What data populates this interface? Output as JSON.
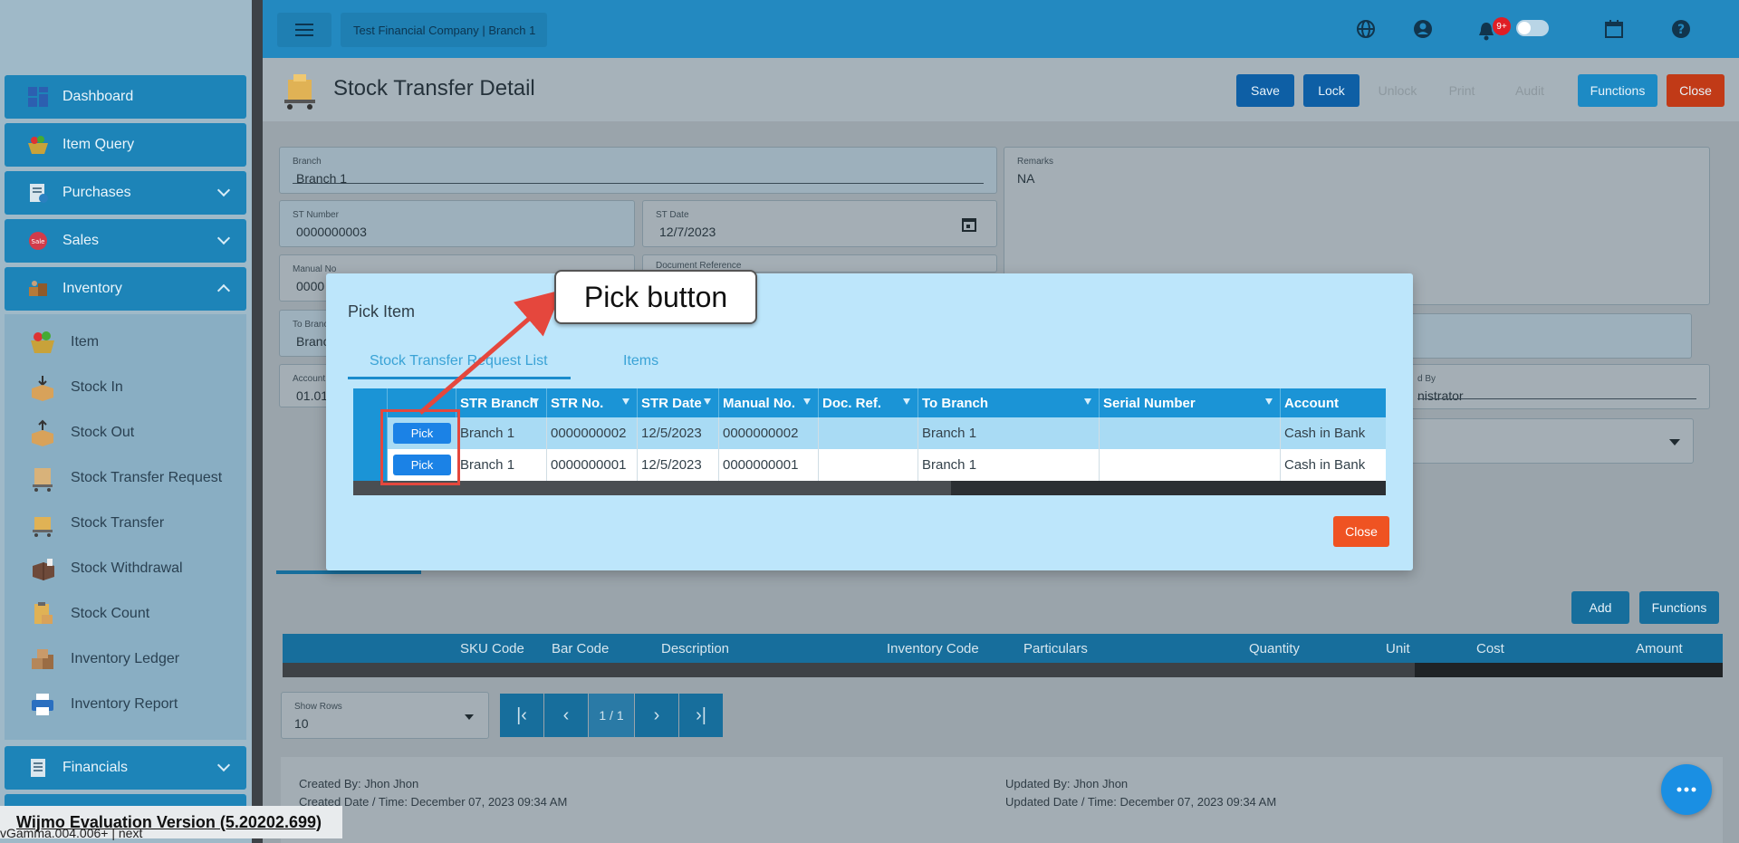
{
  "sidebar": {
    "items": [
      {
        "label": "Dashboard"
      },
      {
        "label": "Item Query"
      },
      {
        "label": "Purchases"
      },
      {
        "label": "Sales"
      },
      {
        "label": "Inventory"
      },
      {
        "label": "Financials"
      }
    ],
    "inventory_sub": [
      {
        "label": "Item"
      },
      {
        "label": "Stock In"
      },
      {
        "label": "Stock Out"
      },
      {
        "label": "Stock Transfer Request"
      },
      {
        "label": "Stock Transfer"
      },
      {
        "label": "Stock Withdrawal"
      },
      {
        "label": "Stock Count"
      },
      {
        "label": "Inventory Ledger"
      },
      {
        "label": "Inventory Report"
      }
    ]
  },
  "topbar": {
    "company": "Test Financial Company | Branch 1",
    "notif_badge": "9+"
  },
  "header": {
    "title": "Stock Transfer Detail",
    "buttons": {
      "save": "Save",
      "lock": "Lock",
      "unlock": "Unlock",
      "print": "Print",
      "audit": "Audit",
      "functions": "Functions",
      "close": "Close"
    }
  },
  "form": {
    "branch_label": "Branch",
    "branch_value": "Branch 1",
    "st_number_label": "ST Number",
    "st_number_value": "0000000003",
    "st_date_label": "ST Date",
    "st_date_value": "12/7/2023",
    "manual_no_label": "Manual No",
    "manual_no_value": "0000",
    "doc_ref_label": "Document Reference",
    "to_branch_label": "To Branch",
    "to_branch_value": "Branc",
    "account_label": "Account",
    "account_value": "01.01",
    "remarks_label": "Remarks",
    "remarks_value": "NA",
    "prepared_by_label": "d By",
    "prepared_by_value": "nistrator"
  },
  "items_section": {
    "add": "Add",
    "functions": "Functions",
    "columns": [
      "SKU Code",
      "Bar Code",
      "Description",
      "Inventory Code",
      "Particulars",
      "Quantity",
      "Unit",
      "Cost",
      "Amount"
    ]
  },
  "pager": {
    "show_rows_label": "Show Rows",
    "show_rows_value": "10",
    "page_info": "1 / 1"
  },
  "footer": {
    "created_by": "Created By: Jhon Jhon",
    "created_date": "Created Date / Time: December 07, 2023 09:34 AM",
    "updated_by": "Updated By: Jhon Jhon",
    "updated_date": "Updated Date / Time: December 07, 2023 09:34 AM"
  },
  "wijmo_notice": "Wijmo Evaluation Version (5.20202.699)",
  "version_text": "vGamma.004.006+ | next",
  "modal": {
    "title": "Pick Item",
    "tabs": [
      "Stock Transfer Request List",
      "Items"
    ],
    "columns": [
      "STR Branch",
      "STR No.",
      "STR Date",
      "Manual No.",
      "Doc. Ref.",
      "To Branch",
      "Serial Number",
      "Account"
    ],
    "pick_label": "Pick",
    "rows": [
      {
        "str_branch": "Branch 1",
        "str_no": "0000000002",
        "str_date": "12/5/2023",
        "manual_no": "0000000002",
        "doc_ref": "",
        "to_branch": "Branch 1",
        "serial_number": "",
        "account": "Cash in Bank"
      },
      {
        "str_branch": "Branch 1",
        "str_no": "0000000001",
        "str_date": "12/5/2023",
        "manual_no": "0000000001",
        "doc_ref": "",
        "to_branch": "Branch 1",
        "serial_number": "",
        "account": "Cash in Bank"
      }
    ],
    "close": "Close"
  },
  "annotation": {
    "callout": "Pick button"
  },
  "colors": {
    "primary": "#1b94d6",
    "close_red": "#ef5322",
    "highlight": "#e5473d"
  }
}
